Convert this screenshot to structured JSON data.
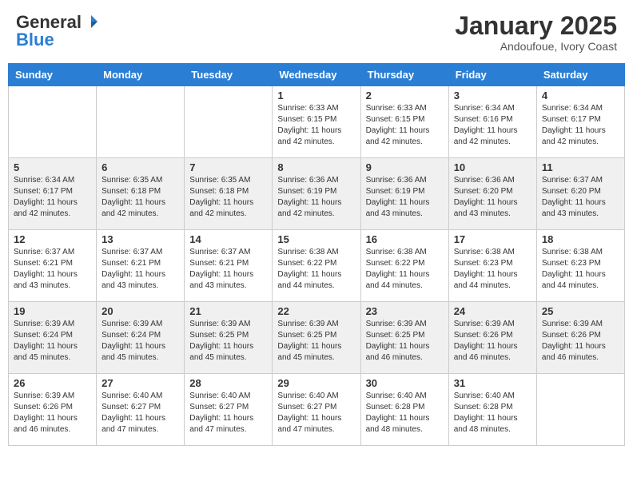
{
  "logo": {
    "general": "General",
    "blue": "Blue"
  },
  "header": {
    "month": "January 2025",
    "location": "Andoufoue, Ivory Coast"
  },
  "days_of_week": [
    "Sunday",
    "Monday",
    "Tuesday",
    "Wednesday",
    "Thursday",
    "Friday",
    "Saturday"
  ],
  "weeks": [
    [
      {
        "day": "",
        "info": ""
      },
      {
        "day": "",
        "info": ""
      },
      {
        "day": "",
        "info": ""
      },
      {
        "day": "1",
        "info": "Sunrise: 6:33 AM\nSunset: 6:15 PM\nDaylight: 11 hours and 42 minutes."
      },
      {
        "day": "2",
        "info": "Sunrise: 6:33 AM\nSunset: 6:15 PM\nDaylight: 11 hours and 42 minutes."
      },
      {
        "day": "3",
        "info": "Sunrise: 6:34 AM\nSunset: 6:16 PM\nDaylight: 11 hours and 42 minutes."
      },
      {
        "day": "4",
        "info": "Sunrise: 6:34 AM\nSunset: 6:17 PM\nDaylight: 11 hours and 42 minutes."
      }
    ],
    [
      {
        "day": "5",
        "info": "Sunrise: 6:34 AM\nSunset: 6:17 PM\nDaylight: 11 hours and 42 minutes."
      },
      {
        "day": "6",
        "info": "Sunrise: 6:35 AM\nSunset: 6:18 PM\nDaylight: 11 hours and 42 minutes."
      },
      {
        "day": "7",
        "info": "Sunrise: 6:35 AM\nSunset: 6:18 PM\nDaylight: 11 hours and 42 minutes."
      },
      {
        "day": "8",
        "info": "Sunrise: 6:36 AM\nSunset: 6:19 PM\nDaylight: 11 hours and 42 minutes."
      },
      {
        "day": "9",
        "info": "Sunrise: 6:36 AM\nSunset: 6:19 PM\nDaylight: 11 hours and 43 minutes."
      },
      {
        "day": "10",
        "info": "Sunrise: 6:36 AM\nSunset: 6:20 PM\nDaylight: 11 hours and 43 minutes."
      },
      {
        "day": "11",
        "info": "Sunrise: 6:37 AM\nSunset: 6:20 PM\nDaylight: 11 hours and 43 minutes."
      }
    ],
    [
      {
        "day": "12",
        "info": "Sunrise: 6:37 AM\nSunset: 6:21 PM\nDaylight: 11 hours and 43 minutes."
      },
      {
        "day": "13",
        "info": "Sunrise: 6:37 AM\nSunset: 6:21 PM\nDaylight: 11 hours and 43 minutes."
      },
      {
        "day": "14",
        "info": "Sunrise: 6:37 AM\nSunset: 6:21 PM\nDaylight: 11 hours and 43 minutes."
      },
      {
        "day": "15",
        "info": "Sunrise: 6:38 AM\nSunset: 6:22 PM\nDaylight: 11 hours and 44 minutes."
      },
      {
        "day": "16",
        "info": "Sunrise: 6:38 AM\nSunset: 6:22 PM\nDaylight: 11 hours and 44 minutes."
      },
      {
        "day": "17",
        "info": "Sunrise: 6:38 AM\nSunset: 6:23 PM\nDaylight: 11 hours and 44 minutes."
      },
      {
        "day": "18",
        "info": "Sunrise: 6:38 AM\nSunset: 6:23 PM\nDaylight: 11 hours and 44 minutes."
      }
    ],
    [
      {
        "day": "19",
        "info": "Sunrise: 6:39 AM\nSunset: 6:24 PM\nDaylight: 11 hours and 45 minutes."
      },
      {
        "day": "20",
        "info": "Sunrise: 6:39 AM\nSunset: 6:24 PM\nDaylight: 11 hours and 45 minutes."
      },
      {
        "day": "21",
        "info": "Sunrise: 6:39 AM\nSunset: 6:25 PM\nDaylight: 11 hours and 45 minutes."
      },
      {
        "day": "22",
        "info": "Sunrise: 6:39 AM\nSunset: 6:25 PM\nDaylight: 11 hours and 45 minutes."
      },
      {
        "day": "23",
        "info": "Sunrise: 6:39 AM\nSunset: 6:25 PM\nDaylight: 11 hours and 46 minutes."
      },
      {
        "day": "24",
        "info": "Sunrise: 6:39 AM\nSunset: 6:26 PM\nDaylight: 11 hours and 46 minutes."
      },
      {
        "day": "25",
        "info": "Sunrise: 6:39 AM\nSunset: 6:26 PM\nDaylight: 11 hours and 46 minutes."
      }
    ],
    [
      {
        "day": "26",
        "info": "Sunrise: 6:39 AM\nSunset: 6:26 PM\nDaylight: 11 hours and 46 minutes."
      },
      {
        "day": "27",
        "info": "Sunrise: 6:40 AM\nSunset: 6:27 PM\nDaylight: 11 hours and 47 minutes."
      },
      {
        "day": "28",
        "info": "Sunrise: 6:40 AM\nSunset: 6:27 PM\nDaylight: 11 hours and 47 minutes."
      },
      {
        "day": "29",
        "info": "Sunrise: 6:40 AM\nSunset: 6:27 PM\nDaylight: 11 hours and 47 minutes."
      },
      {
        "day": "30",
        "info": "Sunrise: 6:40 AM\nSunset: 6:28 PM\nDaylight: 11 hours and 48 minutes."
      },
      {
        "day": "31",
        "info": "Sunrise: 6:40 AM\nSunset: 6:28 PM\nDaylight: 11 hours and 48 minutes."
      },
      {
        "day": "",
        "info": ""
      }
    ]
  ]
}
